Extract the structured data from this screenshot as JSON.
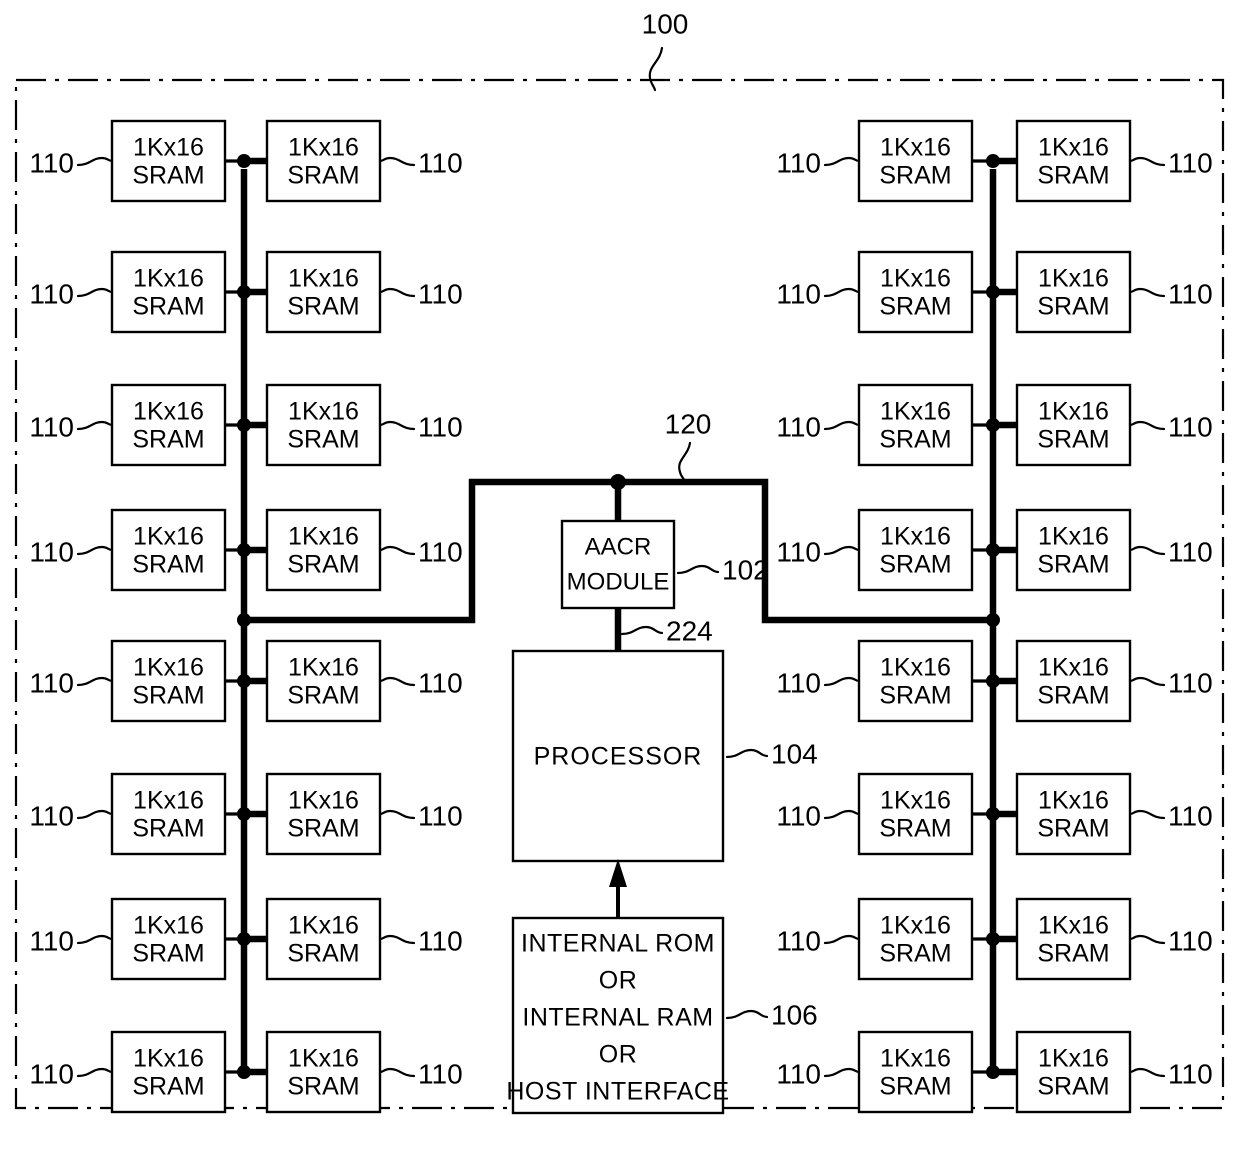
{
  "figure": {
    "figure_ref": "100",
    "bus_ref": "120",
    "processor_link_ref": "224",
    "aacr_ref": "102",
    "processor_ref": "104",
    "memory_source_ref": "106",
    "sram_ref": "110"
  },
  "blocks": {
    "sram": {
      "line1": "1Kx16",
      "line2": "SRAM"
    },
    "aacr": {
      "line1": "AACR",
      "line2": "MODULE"
    },
    "processor": {
      "label": "PROCESSOR"
    },
    "memory_source": {
      "line1": "INTERNAL ROM",
      "line2": "OR",
      "line3": "INTERNAL RAM",
      "line4": "OR",
      "line5": "HOST INTERFACE"
    }
  },
  "left_column": {
    "rows": [
      {
        "inner_label_ref": "110",
        "outer_label_ref": "110"
      },
      {
        "inner_label_ref": "110",
        "outer_label_ref": "110"
      },
      {
        "inner_label_ref": "110",
        "outer_label_ref": "110"
      },
      {
        "inner_label_ref": "110",
        "outer_label_ref": "110"
      },
      {
        "inner_label_ref": "110",
        "outer_label_ref": "110"
      },
      {
        "inner_label_ref": "110",
        "outer_label_ref": "110"
      },
      {
        "inner_label_ref": "110",
        "outer_label_ref": "110"
      },
      {
        "inner_label_ref": "110",
        "outer_label_ref": "110"
      }
    ]
  },
  "right_column": {
    "rows": [
      {
        "inner_label_ref": "110",
        "outer_label_ref": "110"
      },
      {
        "inner_label_ref": "110",
        "outer_label_ref": "110"
      },
      {
        "inner_label_ref": "110",
        "outer_label_ref": "110"
      },
      {
        "inner_label_ref": "110",
        "outer_label_ref": "110"
      },
      {
        "inner_label_ref": "110",
        "outer_label_ref": "110"
      },
      {
        "inner_label_ref": "110",
        "outer_label_ref": "110"
      },
      {
        "inner_label_ref": "110",
        "outer_label_ref": "110"
      },
      {
        "inner_label_ref": "110",
        "outer_label_ref": "110"
      }
    ]
  },
  "colors": {
    "ink": "#000000",
    "paper": "#ffffff"
  }
}
